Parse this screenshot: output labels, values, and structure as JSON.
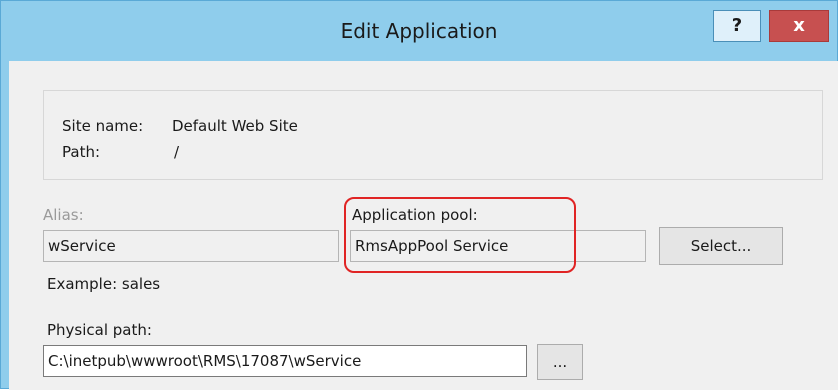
{
  "window": {
    "title": "Edit Application",
    "help_label": "?",
    "close_label": "x"
  },
  "site": {
    "name_label": "Site name:",
    "name_value": "Default Web Site",
    "path_label": "Path:",
    "path_value": "/"
  },
  "alias": {
    "label": "Alias:",
    "value": "wService",
    "example": "Example: sales"
  },
  "app_pool": {
    "label": "Application pool:",
    "value": "RmsAppPool Service",
    "select_label": "Select..."
  },
  "physical_path": {
    "label": "Physical path:",
    "value": "C:\\inetpub\\wwwroot\\RMS\\17087\\wService",
    "browse_label": "..."
  },
  "colors": {
    "frame": "#8fcdec",
    "close_button": "#c75050",
    "highlight": "#e02424",
    "client_background": "#f0f0f0"
  }
}
